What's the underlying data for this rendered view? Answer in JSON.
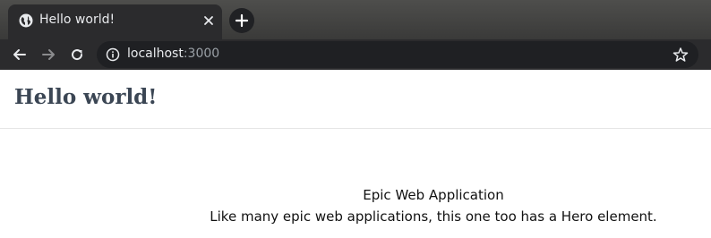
{
  "browser": {
    "tab": {
      "title": "Hello world!",
      "favicon": "globe-icon",
      "close_icon": "close-icon"
    },
    "new_tab_icon": "plus-icon",
    "nav": {
      "back_icon": "arrow-left-icon",
      "forward_icon": "arrow-right-icon",
      "reload_icon": "reload-icon"
    },
    "address_bar": {
      "info_icon": "info-icon",
      "host": "localhost",
      "port": ":3000",
      "bookmark_icon": "star-icon"
    },
    "colors": {
      "tabstrip": "#3c3c3b",
      "toolbar": "#2b2b2d",
      "omnibox": "#1f2023"
    }
  },
  "page": {
    "header": {
      "title": "Hello world!"
    },
    "hero": {
      "title": "Epic Web Application",
      "text": "Like many epic web applications, this one too has a Hero element."
    }
  }
}
